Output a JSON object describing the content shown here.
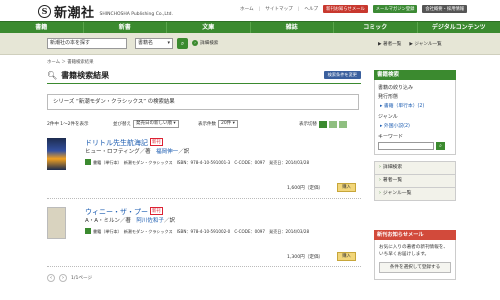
{
  "header": {
    "logo_mark": "S",
    "logo_name": "新潮社",
    "logo_en": "SHINCHOSHA Publishing Co.,Ltd.",
    "top_links": [
      "ホーム",
      "サイトマップ",
      "ヘルプ"
    ],
    "badges": [
      "新刊お知らせメール",
      "メールマガジン登録",
      "会社概要・採用情報"
    ]
  },
  "global_nav": [
    "書籍",
    "新書",
    "文庫",
    "雑誌",
    "コミック",
    "デジタルコンテンツ"
  ],
  "search": {
    "input_value": "新潮社の本を探す",
    "select_value": "書籍名",
    "advanced_label": "詳細検索",
    "right_links": [
      "▶ 著者一覧",
      "▶ ジャンル一覧"
    ]
  },
  "breadcrumb": "ホーム ＞ 書籍検索結果",
  "main": {
    "title": "書籍検索結果",
    "change_button": "検索条件を変更",
    "series_text": "シリーズ “新潮モダン・クラシックス” の検索結果",
    "result_count": "2件中 1〜2件を表示",
    "sort_label": "並び替え",
    "sort_value": "発売日の新しい順",
    "per_page_label": "表示件数",
    "per_page_value": "20件",
    "view_label": "表示切替"
  },
  "books": [
    {
      "title": "ドリトル先生航海記",
      "new_tag": "新刊",
      "author_prefix": "ヒュー・ロフティング／著　",
      "author_link": "福岡伸一",
      "author_suffix": "／訳",
      "meta": "書籍（単行本）　新潮モダン・クラシックス　ISBN：978-4-10-591001-3　C-CODE：0097　発売日：2014/03/28",
      "price": "1,600円（定価）",
      "cart": "購入"
    },
    {
      "title": "ウィニー・ザ・プー",
      "new_tag": "新刊",
      "author_prefix": "A・A・ミルン／著　",
      "author_link": "阿川佐和子",
      "author_suffix": "／訳",
      "meta": "書籍（単行本）　新潮モダン・クラシックス　ISBN：978-4-10-591002-0　C-CODE：0097　発売日：2014/03/28",
      "price": "1,300円（定価）",
      "cart": "購入"
    }
  ],
  "pager": {
    "text": "1/1ページ"
  },
  "sidebar": {
    "head": "書籍検索",
    "narrow_label": "書籍の絞り込み",
    "format_label": "発行形態",
    "format_link": "▸ 書籍（単行本）(2)",
    "genre_label": "ジャンル",
    "genre_link": "▸ 外国小説(2)",
    "keyword_label": "キーワード",
    "nav": [
      "詳細検索",
      "著者一覧",
      "ジャンル一覧"
    ],
    "mail_head": "新刊お知らせメール",
    "mail_text": "お気に入りの著者の新刊情報を、いち早くお届けします。",
    "mail_button": "条件を選択して登録する"
  },
  "colors": {
    "brand_green": "#3b8a2f",
    "accent_red": "#c8382e",
    "link_blue": "#1a5bb0"
  }
}
